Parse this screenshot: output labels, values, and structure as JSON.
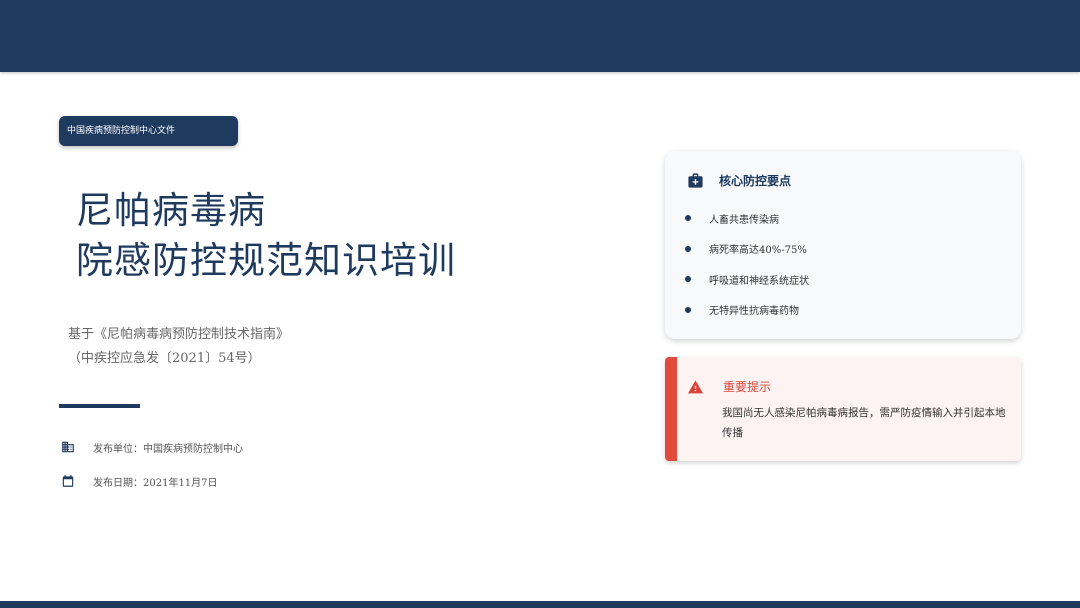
{
  "header": {
    "tag": "中国疾病预防控制中心文件"
  },
  "title": {
    "line1": "尼帕病毒病",
    "line2": "院感防控规范知识培训"
  },
  "subtitle": {
    "line1": "基于《尼帕病毒病预防控制技术指南》",
    "line2": "（中疾控应急发〔2021〕54号）"
  },
  "meta": {
    "unit": {
      "icon": "building-icon",
      "text": "发布单位：中国疾病预防控制中心"
    },
    "date": {
      "icon": "calendar-icon",
      "text": "发布日期：2021年11月7日"
    }
  },
  "key_points": {
    "icon": "medical-kit-icon",
    "title": "核心防控要点",
    "items": [
      "人畜共患传染病",
      "病死率高达40%-75%",
      "呼吸道和神经系统症状",
      "无特异性抗病毒药物"
    ]
  },
  "alert": {
    "icon": "warning-icon",
    "title": "重要提示",
    "text": "我国尚无人感染尼帕病毒病报告，需严防疫情输入并引起本地传播"
  },
  "colors": {
    "primary": "#1f3a5f",
    "alert": "#e14b3b",
    "alert_bg": "#fdf3f3"
  }
}
